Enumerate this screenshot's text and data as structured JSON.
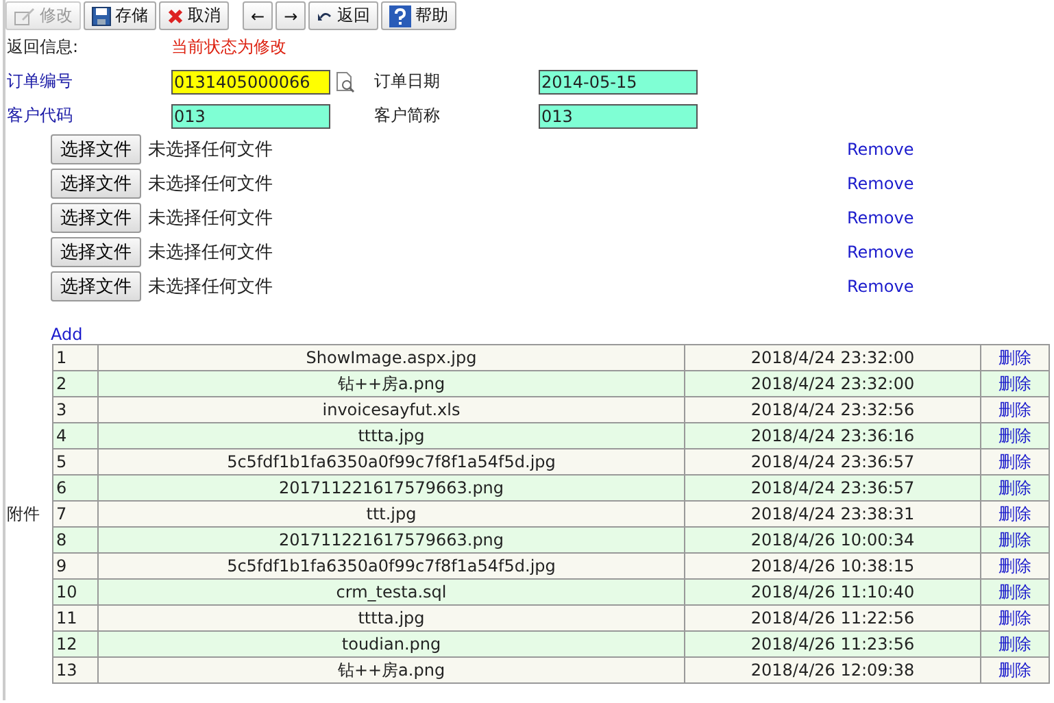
{
  "toolbar": [
    {
      "kind": "edit",
      "label": "修改",
      "disabled": true
    },
    {
      "kind": "save",
      "label": "存储",
      "disabled": false
    },
    {
      "kind": "cancel",
      "label": "取消",
      "disabled": false
    },
    {
      "kind": "prev",
      "label": "←",
      "disabled": false
    },
    {
      "kind": "next",
      "label": "→",
      "disabled": false
    },
    {
      "kind": "back",
      "label": "返回",
      "disabled": false
    },
    {
      "kind": "help",
      "label": "帮助",
      "disabled": false
    }
  ],
  "message": {
    "label": "返回信息:",
    "text": "当前状态为修改"
  },
  "fields": [
    {
      "label": "订单编号",
      "value": "0131405000066",
      "color": "#ffff00",
      "lookup": true,
      "link": true
    },
    {
      "label": "订单日期",
      "value": "2014-05-15",
      "color": "#7fffd4",
      "lookup": false,
      "link": false
    },
    {
      "label": "客户代码",
      "value": "013",
      "color": "#7fffd4",
      "lookup": false,
      "link": true
    },
    {
      "label": "客户简称",
      "value": "013",
      "color": "#7fffd4",
      "lookup": false,
      "link": false
    }
  ],
  "uploads": [
    {
      "button": "选择文件",
      "status": "未选择任何文件",
      "remove": "Remove"
    },
    {
      "button": "选择文件",
      "status": "未选择任何文件",
      "remove": "Remove"
    },
    {
      "button": "选择文件",
      "status": "未选择任何文件",
      "remove": "Remove"
    },
    {
      "button": "选择文件",
      "status": "未选择任何文件",
      "remove": "Remove"
    },
    {
      "button": "选择文件",
      "status": "未选择任何文件",
      "remove": "Remove"
    }
  ],
  "add_link": "Add",
  "attachments": {
    "label": "附件",
    "rows": [
      {
        "no": "1",
        "name": "ShowImage.aspx.jpg",
        "time": "2018/4/24 23:32:00",
        "action": "删除"
      },
      {
        "no": "2",
        "name": "钻++房a.png",
        "time": "2018/4/24 23:32:00",
        "action": "删除"
      },
      {
        "no": "3",
        "name": "invoicesayfut.xls",
        "time": "2018/4/24 23:32:56",
        "action": "删除"
      },
      {
        "no": "4",
        "name": "tttta.jpg",
        "time": "2018/4/24 23:36:16",
        "action": "删除"
      },
      {
        "no": "5",
        "name": "5c5fdf1b1fa6350a0f99c7f8f1a54f5d.jpg",
        "time": "2018/4/24 23:36:57",
        "action": "删除"
      },
      {
        "no": "6",
        "name": "201711221617579663.png",
        "time": "2018/4/24 23:36:57",
        "action": "删除"
      },
      {
        "no": "7",
        "name": "ttt.jpg",
        "time": "2018/4/24 23:38:31",
        "action": "删除"
      },
      {
        "no": "8",
        "name": "201711221617579663.png",
        "time": "2018/4/26 10:00:34",
        "action": "删除"
      },
      {
        "no": "9",
        "name": "5c5fdf1b1fa6350a0f99c7f8f1a54f5d.jpg",
        "time": "2018/4/26 10:38:15",
        "action": "删除"
      },
      {
        "no": "10",
        "name": "crm_testa.sql",
        "time": "2018/4/26 11:10:40",
        "action": "删除"
      },
      {
        "no": "11",
        "name": "tttta.jpg",
        "time": "2018/4/26 11:22:56",
        "action": "删除"
      },
      {
        "no": "12",
        "name": "toudian.png",
        "time": "2018/4/26 11:23:56",
        "action": "删除"
      },
      {
        "no": "13",
        "name": "钻++房a.png",
        "time": "2018/4/26 12:09:38",
        "action": "删除"
      }
    ]
  }
}
